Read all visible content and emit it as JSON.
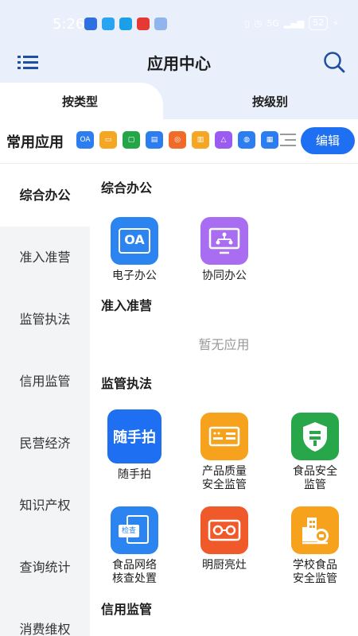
{
  "status": {
    "time": "5:26",
    "battery": "52",
    "signal": "5G"
  },
  "header": {
    "title": "应用中心"
  },
  "tabs": [
    {
      "label": "按类型"
    },
    {
      "label": "按级别"
    }
  ],
  "common": {
    "label": "常用应用",
    "edit_label": "编辑",
    "oa_text": "OA"
  },
  "sidebar": {
    "items": [
      {
        "label": "综合办公"
      },
      {
        "label": "准入准营"
      },
      {
        "label": "监管执法"
      },
      {
        "label": "信用监管"
      },
      {
        "label": "民营经济"
      },
      {
        "label": "知识产权"
      },
      {
        "label": "查询统计"
      },
      {
        "label": "消费维权"
      }
    ]
  },
  "sections": {
    "office": {
      "title": "综合办公",
      "apps": [
        {
          "label": "电子办公",
          "icon": "oa-icon",
          "icon_text": "OA"
        },
        {
          "label": "协同办公",
          "icon": "collaboration-icon"
        }
      ]
    },
    "access": {
      "title": "准入准营",
      "empty": "暂无应用"
    },
    "enforcement": {
      "title": "监管执法",
      "apps": [
        {
          "label": "随手拍",
          "icon": "snapshot-icon",
          "icon_text": "随手拍"
        },
        {
          "label_line1": "产品质量",
          "label_line2": "安全监管",
          "icon": "product-quality-icon"
        },
        {
          "label_line1": "食品安全",
          "label_line2": "监管",
          "icon": "food-safety-icon"
        },
        {
          "label_line1": "食品网络",
          "label_line2": "核查处置",
          "icon": "food-network-icon",
          "icon_text": "检查"
        },
        {
          "label": "明厨亮灶",
          "icon": "kitchen-icon"
        },
        {
          "label_line1": "学校食品",
          "label_line2": "安全监管",
          "icon": "school-food-icon"
        }
      ]
    },
    "credit": {
      "title": "信用监管"
    }
  },
  "colors": {
    "accent": "#1f6ff2",
    "header_bg": "#e9f0fb",
    "sidebar_bg": "#f3f4f6"
  }
}
